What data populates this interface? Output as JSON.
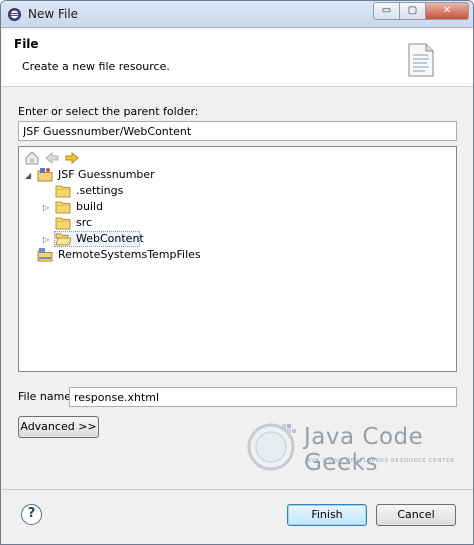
{
  "window": {
    "title": "New File",
    "min_glyph": "▭",
    "max_glyph": "▢",
    "close_glyph": "✕"
  },
  "header": {
    "title": "File",
    "description": "Create a new file resource."
  },
  "parent_folder": {
    "label": "Enter or select the parent folder:",
    "value": "JSF Guessnumber/WebContent"
  },
  "tree": {
    "nodes": [
      {
        "label": "JSF Guessnumber",
        "expanded": true,
        "type": "project"
      },
      {
        "label": ".settings",
        "type": "folder"
      },
      {
        "label": "build",
        "type": "folder",
        "expandable": true
      },
      {
        "label": "src",
        "type": "folder"
      },
      {
        "label": "WebContent",
        "type": "folder",
        "expandable": true,
        "selected": true
      },
      {
        "label": "RemoteSystemsTempFiles",
        "type": "project"
      }
    ],
    "twisty_expanded": "◢",
    "twisty_collapsed": "▷"
  },
  "file_name": {
    "label": "File name:",
    "value": "response.xhtml"
  },
  "buttons": {
    "advanced": "Advanced >>",
    "finish": "Finish",
    "cancel": "Cancel",
    "help": "?"
  },
  "watermark": {
    "name": "Java Code Geeks",
    "tagline": "JAVA 2 JAVA DEVELOPERS RESOURCE CENTER"
  }
}
